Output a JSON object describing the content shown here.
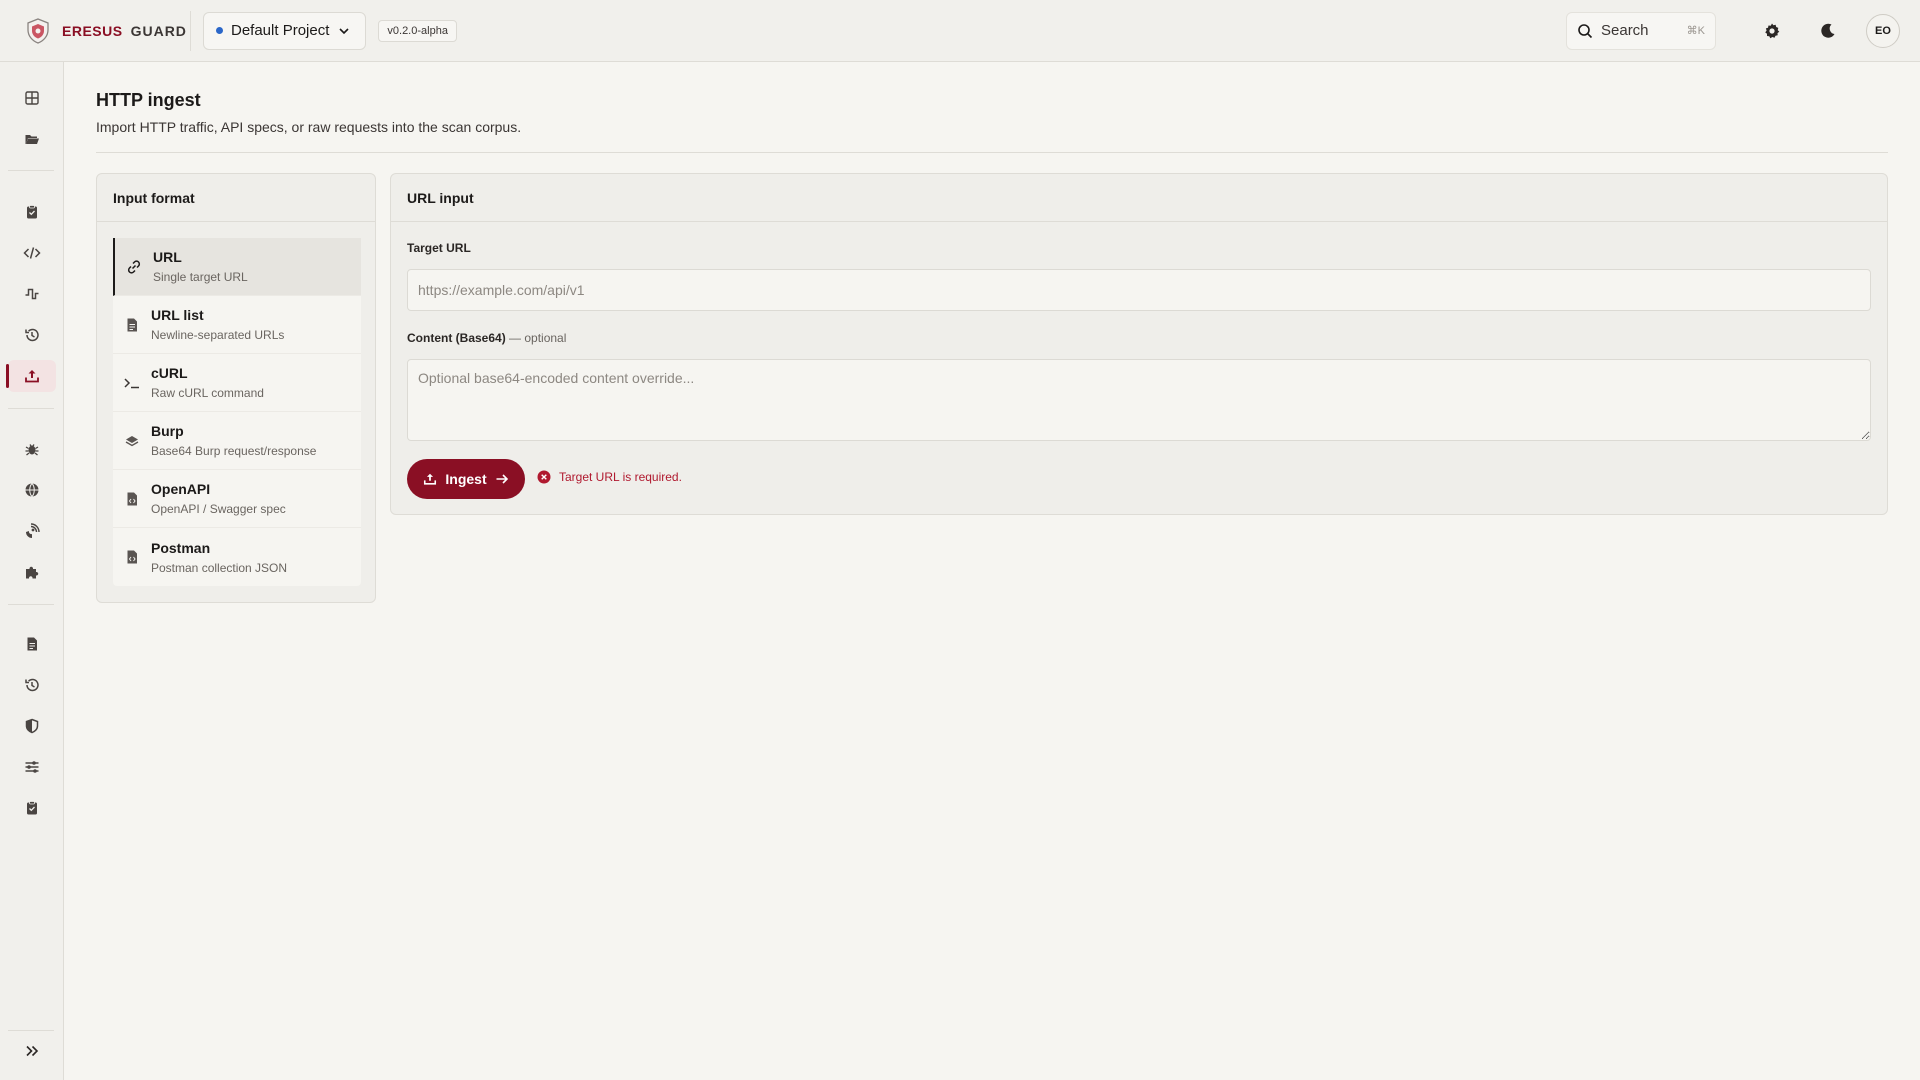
{
  "brand": {
    "name": "ERESUS",
    "sub": "GUARD"
  },
  "topbar": {
    "project": "Default Project",
    "version": "v0.2.0-alpha",
    "search_label": "Search",
    "search_shortcut": "⌘K",
    "avatar_initials": "EO"
  },
  "page": {
    "title": "HTTP ingest",
    "subtitle": "Import HTTP traffic, API specs, or raw requests into the scan corpus."
  },
  "format_panel": {
    "title": "Input format",
    "selected": "URL",
    "items": [
      {
        "label": "URL",
        "desc": "Single target URL",
        "icon": "link-icon"
      },
      {
        "label": "URL list",
        "desc": "Newline-separated URLs",
        "icon": "file-icon"
      },
      {
        "label": "cURL",
        "desc": "Raw cURL command",
        "icon": "terminal-icon"
      },
      {
        "label": "Burp",
        "desc": "Base64 Burp request/response",
        "icon": "layers-icon"
      },
      {
        "label": "OpenAPI",
        "desc": "OpenAPI / Swagger spec",
        "icon": "code-file-icon"
      },
      {
        "label": "Postman",
        "desc": "Postman collection JSON",
        "icon": "code-file-icon"
      }
    ]
  },
  "url_panel": {
    "title": "URL input",
    "target_label": "Target URL",
    "target_value": "",
    "target_placeholder": "https://example.com/api/v1",
    "content_label": "Content (Base64)",
    "content_optional": "— optional",
    "content_value": "",
    "content_placeholder": "Optional base64-encoded content override...",
    "ingest_label": "Ingest",
    "error": "Target URL is required."
  },
  "colors": {
    "accent": "#8a0f24",
    "error": "#b0192f",
    "background": "#f6f5f1"
  }
}
